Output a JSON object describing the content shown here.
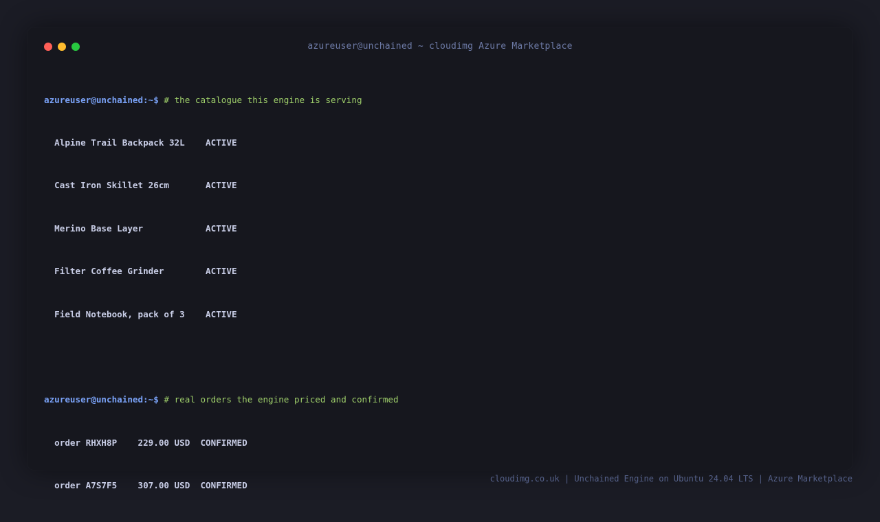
{
  "window": {
    "title": "azureuser@unchained ~ cloudimg Azure Marketplace"
  },
  "terminal": {
    "prompt": "azureuser@unchained:~$",
    "block1": {
      "command": "# the catalogue this engine is serving",
      "rows": [
        "Alpine Trail Backpack 32L    ACTIVE",
        "Cast Iron Skillet 26cm       ACTIVE",
        "Merino Base Layer            ACTIVE",
        "Filter Coffee Grinder        ACTIVE",
        "Field Notebook, pack of 3    ACTIVE"
      ]
    },
    "block2": {
      "command": "# real orders the engine priced and confirmed",
      "rows": [
        "order RHXH8P    229.00 USD  CONFIRMED",
        "order A7S7F5    307.00 USD  CONFIRMED"
      ]
    }
  },
  "footer": {
    "text": "cloudimg.co.uk | Unchained Engine on Ubuntu 24.04 LTS | Azure Marketplace"
  },
  "colors": {
    "background": "#1b1c25",
    "window": "#16171e",
    "prompt": "#7aa2f7",
    "comment": "#9ece6a",
    "output": "#c8cde6",
    "title": "#6d7aa6",
    "footer": "#55618a"
  },
  "icons": [
    "close-dot-icon",
    "minimize-dot-icon",
    "maximize-dot-icon"
  ]
}
